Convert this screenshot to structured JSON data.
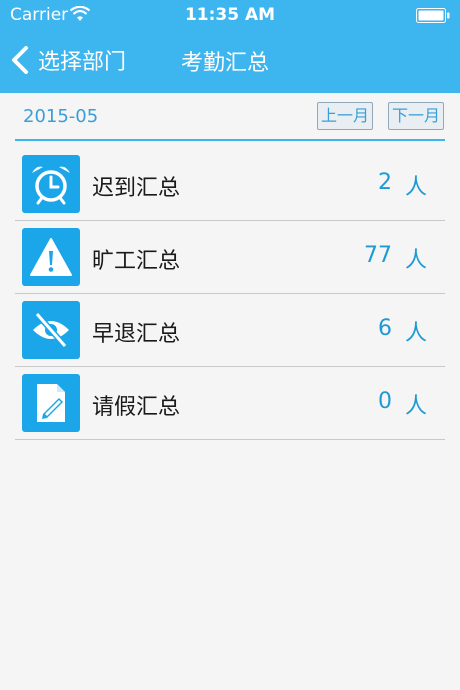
{
  "status": {
    "carrier": "Carrier",
    "time": "11:35 AM"
  },
  "nav": {
    "back_label": "选择部门",
    "title": "考勤汇总"
  },
  "month_bar": {
    "month": "2015-05",
    "prev_label": "上一月",
    "next_label": "下一月"
  },
  "summary": [
    {
      "icon": "alarm-clock-icon",
      "label": "迟到汇总",
      "count": "2",
      "unit": "人"
    },
    {
      "icon": "warning-icon",
      "label": "旷工汇总",
      "count": "77",
      "unit": "人"
    },
    {
      "icon": "eye-slash-icon",
      "label": "早退汇总",
      "count": "6",
      "unit": "人"
    },
    {
      "icon": "document-edit-icon",
      "label": "请假汇总",
      "count": "0",
      "unit": "人"
    }
  ],
  "colors": {
    "accent": "#3db5ef",
    "icon_bg": "#1aa6e8",
    "count_text": "#1d9ad4"
  }
}
